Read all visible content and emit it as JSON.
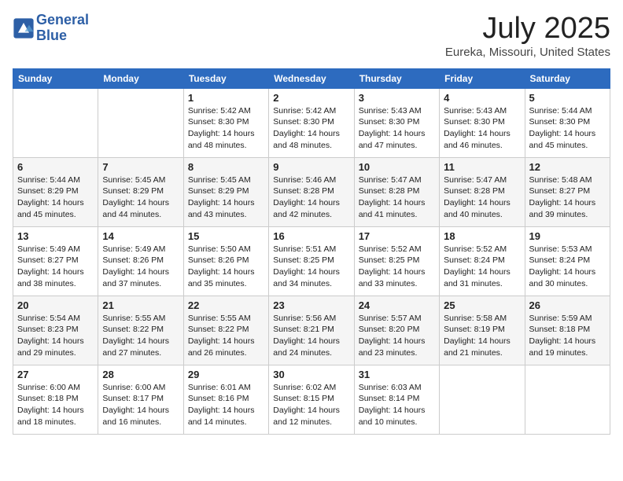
{
  "header": {
    "logo_line1": "General",
    "logo_line2": "Blue",
    "month": "July 2025",
    "location": "Eureka, Missouri, United States"
  },
  "days_of_week": [
    "Sunday",
    "Monday",
    "Tuesday",
    "Wednesday",
    "Thursday",
    "Friday",
    "Saturday"
  ],
  "weeks": [
    [
      {
        "day": "",
        "info": ""
      },
      {
        "day": "",
        "info": ""
      },
      {
        "day": "1",
        "info": "Sunrise: 5:42 AM\nSunset: 8:30 PM\nDaylight: 14 hours and 48 minutes."
      },
      {
        "day": "2",
        "info": "Sunrise: 5:42 AM\nSunset: 8:30 PM\nDaylight: 14 hours and 48 minutes."
      },
      {
        "day": "3",
        "info": "Sunrise: 5:43 AM\nSunset: 8:30 PM\nDaylight: 14 hours and 47 minutes."
      },
      {
        "day": "4",
        "info": "Sunrise: 5:43 AM\nSunset: 8:30 PM\nDaylight: 14 hours and 46 minutes."
      },
      {
        "day": "5",
        "info": "Sunrise: 5:44 AM\nSunset: 8:30 PM\nDaylight: 14 hours and 45 minutes."
      }
    ],
    [
      {
        "day": "6",
        "info": "Sunrise: 5:44 AM\nSunset: 8:29 PM\nDaylight: 14 hours and 45 minutes."
      },
      {
        "day": "7",
        "info": "Sunrise: 5:45 AM\nSunset: 8:29 PM\nDaylight: 14 hours and 44 minutes."
      },
      {
        "day": "8",
        "info": "Sunrise: 5:45 AM\nSunset: 8:29 PM\nDaylight: 14 hours and 43 minutes."
      },
      {
        "day": "9",
        "info": "Sunrise: 5:46 AM\nSunset: 8:28 PM\nDaylight: 14 hours and 42 minutes."
      },
      {
        "day": "10",
        "info": "Sunrise: 5:47 AM\nSunset: 8:28 PM\nDaylight: 14 hours and 41 minutes."
      },
      {
        "day": "11",
        "info": "Sunrise: 5:47 AM\nSunset: 8:28 PM\nDaylight: 14 hours and 40 minutes."
      },
      {
        "day": "12",
        "info": "Sunrise: 5:48 AM\nSunset: 8:27 PM\nDaylight: 14 hours and 39 minutes."
      }
    ],
    [
      {
        "day": "13",
        "info": "Sunrise: 5:49 AM\nSunset: 8:27 PM\nDaylight: 14 hours and 38 minutes."
      },
      {
        "day": "14",
        "info": "Sunrise: 5:49 AM\nSunset: 8:26 PM\nDaylight: 14 hours and 37 minutes."
      },
      {
        "day": "15",
        "info": "Sunrise: 5:50 AM\nSunset: 8:26 PM\nDaylight: 14 hours and 35 minutes."
      },
      {
        "day": "16",
        "info": "Sunrise: 5:51 AM\nSunset: 8:25 PM\nDaylight: 14 hours and 34 minutes."
      },
      {
        "day": "17",
        "info": "Sunrise: 5:52 AM\nSunset: 8:25 PM\nDaylight: 14 hours and 33 minutes."
      },
      {
        "day": "18",
        "info": "Sunrise: 5:52 AM\nSunset: 8:24 PM\nDaylight: 14 hours and 31 minutes."
      },
      {
        "day": "19",
        "info": "Sunrise: 5:53 AM\nSunset: 8:24 PM\nDaylight: 14 hours and 30 minutes."
      }
    ],
    [
      {
        "day": "20",
        "info": "Sunrise: 5:54 AM\nSunset: 8:23 PM\nDaylight: 14 hours and 29 minutes."
      },
      {
        "day": "21",
        "info": "Sunrise: 5:55 AM\nSunset: 8:22 PM\nDaylight: 14 hours and 27 minutes."
      },
      {
        "day": "22",
        "info": "Sunrise: 5:55 AM\nSunset: 8:22 PM\nDaylight: 14 hours and 26 minutes."
      },
      {
        "day": "23",
        "info": "Sunrise: 5:56 AM\nSunset: 8:21 PM\nDaylight: 14 hours and 24 minutes."
      },
      {
        "day": "24",
        "info": "Sunrise: 5:57 AM\nSunset: 8:20 PM\nDaylight: 14 hours and 23 minutes."
      },
      {
        "day": "25",
        "info": "Sunrise: 5:58 AM\nSunset: 8:19 PM\nDaylight: 14 hours and 21 minutes."
      },
      {
        "day": "26",
        "info": "Sunrise: 5:59 AM\nSunset: 8:18 PM\nDaylight: 14 hours and 19 minutes."
      }
    ],
    [
      {
        "day": "27",
        "info": "Sunrise: 6:00 AM\nSunset: 8:18 PM\nDaylight: 14 hours and 18 minutes."
      },
      {
        "day": "28",
        "info": "Sunrise: 6:00 AM\nSunset: 8:17 PM\nDaylight: 14 hours and 16 minutes."
      },
      {
        "day": "29",
        "info": "Sunrise: 6:01 AM\nSunset: 8:16 PM\nDaylight: 14 hours and 14 minutes."
      },
      {
        "day": "30",
        "info": "Sunrise: 6:02 AM\nSunset: 8:15 PM\nDaylight: 14 hours and 12 minutes."
      },
      {
        "day": "31",
        "info": "Sunrise: 6:03 AM\nSunset: 8:14 PM\nDaylight: 14 hours and 10 minutes."
      },
      {
        "day": "",
        "info": ""
      },
      {
        "day": "",
        "info": ""
      }
    ]
  ]
}
